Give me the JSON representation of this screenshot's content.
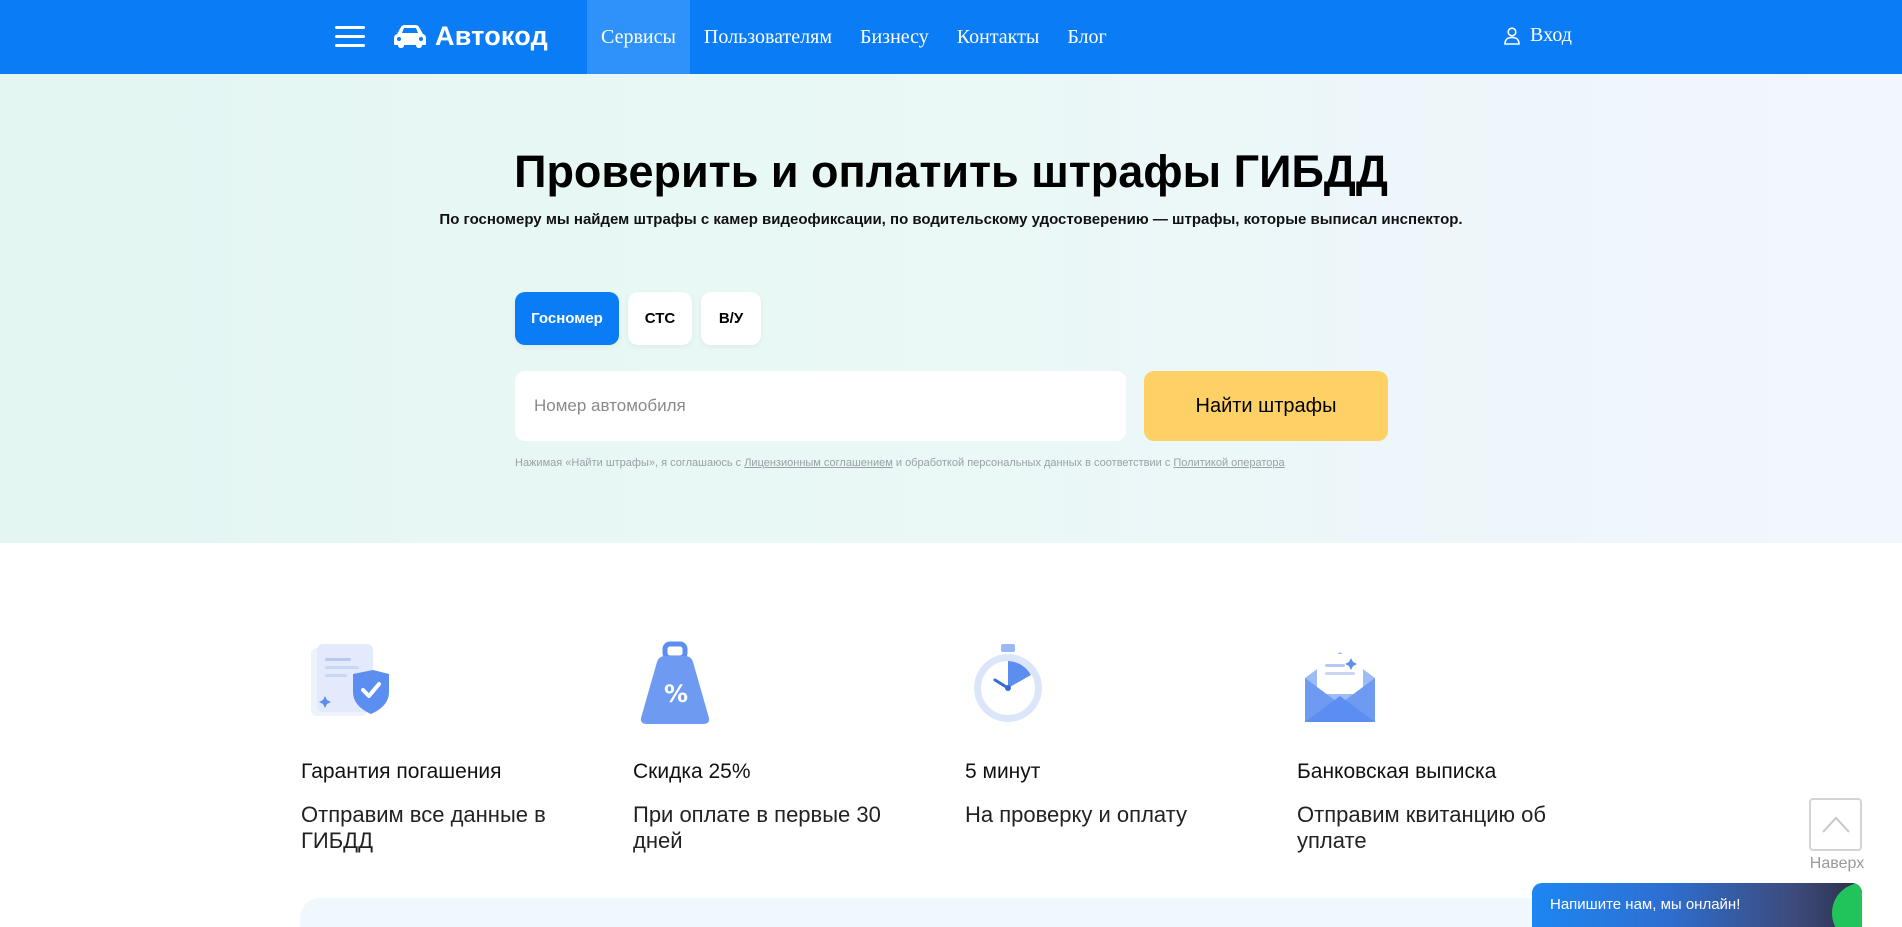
{
  "header": {
    "logo_text": "Автокод",
    "nav": [
      {
        "label": "Сервисы",
        "active": true
      },
      {
        "label": "Пользователям",
        "active": false
      },
      {
        "label": "Бизнесу",
        "active": false
      },
      {
        "label": "Контакты",
        "active": false
      },
      {
        "label": "Блог",
        "active": false
      }
    ],
    "login_label": "Вход"
  },
  "hero": {
    "title": "Проверить и оплатить штрафы ГИБДД",
    "subtitle": "По госномеру мы найдем штрафы с камер видеофиксации, по водительскому удостоверению — штрафы, которые выписал инспектор.",
    "tabs": [
      {
        "label": "Госномер",
        "active": true
      },
      {
        "label": "СТС",
        "active": false
      },
      {
        "label": "В/У",
        "active": false
      }
    ],
    "search_placeholder": "Номер автомобиля",
    "search_value": "",
    "search_button": "Найти штрафы",
    "legal": {
      "prefix": "Нажимая «Найти штрафы», я соглашаюсь с ",
      "link1": "Лицензионным соглашением",
      "middle": " и обработкой персональных данных в соответствии с ",
      "link2": "Политикой оператора"
    }
  },
  "features": [
    {
      "icon": "shield-document-icon",
      "title": "Гарантия погашения",
      "desc": "Отправим все данные в ГИБДД"
    },
    {
      "icon": "percent-bag-icon",
      "title": "Скидка 25%",
      "desc": "При оплате в первые 30 дней"
    },
    {
      "icon": "stopwatch-icon",
      "title": "5 минут",
      "desc": "На проверку и оплату"
    },
    {
      "icon": "envelope-icon",
      "title": "Банковская выписка",
      "desc": "Отправим квитанцию об уплате"
    }
  ],
  "scroll_top_label": "Наверх",
  "chat_label": "Напишите нам, мы онлайн!",
  "colors": {
    "brand_blue": "#0a7cf6",
    "nav_active": "#2f92fa",
    "cta_yellow": "#fdd165",
    "hero_bg": "#e6f7f3",
    "chat_online": "#21c35b"
  }
}
